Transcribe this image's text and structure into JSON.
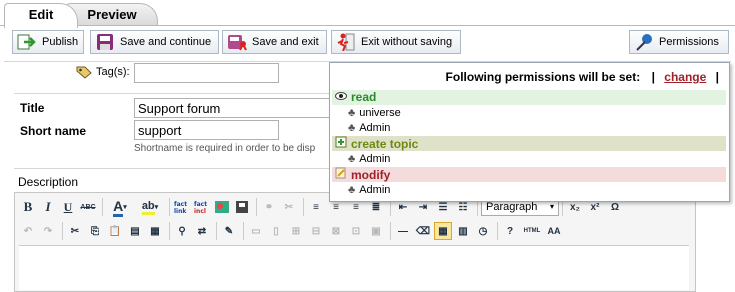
{
  "tabs": {
    "edit": "Edit",
    "preview": "Preview"
  },
  "toolbar": {
    "publish": "Publish",
    "save_continue": "Save and continue",
    "save_exit": "Save and exit",
    "exit_without_saving": "Exit without saving",
    "permissions": "Permissions"
  },
  "form": {
    "tags_label": "Tag(s):",
    "tags_value": "",
    "title_label": "Title",
    "title_value": "Support forum",
    "shortname_label": "Short name",
    "shortname_value": "support",
    "shortname_hint": "Shortname is required in order to be disp",
    "description_label": "Description"
  },
  "permissions_popup": {
    "heading": "Following permissions will be set:",
    "pipe": "|",
    "change_link": "change",
    "groups": [
      {
        "name": "read",
        "members": [
          "universe",
          "Admin"
        ]
      },
      {
        "name": "create topic",
        "members": [
          "Admin"
        ]
      },
      {
        "name": "modify",
        "members": [
          "Admin"
        ]
      }
    ]
  },
  "editor": {
    "format_select": "Paragraph",
    "button_labels": [
      "B",
      "I",
      "U",
      "ABC",
      "A",
      "ab",
      "HTML",
      "AA"
    ]
  },
  "colors": {
    "read_bg": "#e2f3e1",
    "read_text": "#2b8a2b",
    "create_bg": "#dfe2c9",
    "create_text": "#6c8a10",
    "modify_bg": "#f4dcdc",
    "modify_text": "#a0202a",
    "change_link": "#a0202a"
  }
}
